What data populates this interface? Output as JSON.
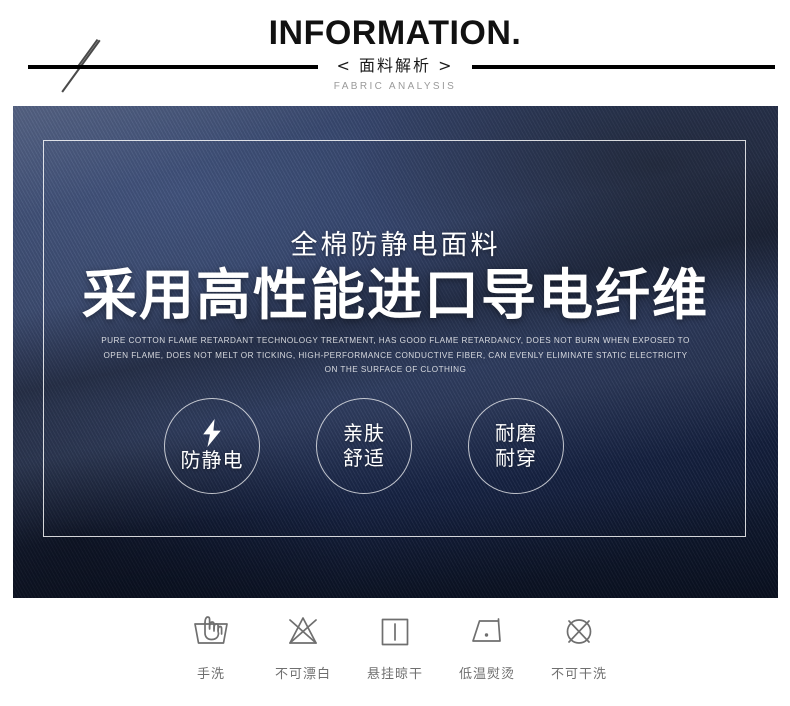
{
  "header": {
    "title": "INFORMATION.",
    "cn_subtitle": "< 面料解析 >",
    "en_subtitle": "FABRIC ANALYSIS",
    "decoration": "diagonal-slashes"
  },
  "hero": {
    "sub_headline": "全棉防静电面料",
    "headline": "采用高性能进口导电纤维",
    "english_description": "PURE COTTON FLAME RETARDANT TECHNOLOGY TREATMENT, HAS GOOD FLAME RETARDANCY, DOES NOT BURN WHEN EXPOSED TO OPEN FLAME, DOES NOT MELT OR TICKING, HIGH-PERFORMANCE CONDUCTIVE FIBER, CAN EVENLY ELIMINATE STATIC ELECTRICITY ON THE SURFACE OF CLOTHING",
    "background_color": "#1b2a4f",
    "frame_color": "#ffffff",
    "features": [
      {
        "icon": "lightning-bolt-icon",
        "line1": "防静电",
        "line2": ""
      },
      {
        "icon": "",
        "line1": "亲肤",
        "line2": "舒适"
      },
      {
        "icon": "",
        "line1": "耐磨",
        "line2": "耐穿"
      }
    ]
  },
  "care_instructions": [
    {
      "icon": "hand-wash-icon",
      "label": "手洗"
    },
    {
      "icon": "do-not-bleach-icon",
      "label": "不可漂白"
    },
    {
      "icon": "line-dry-icon",
      "label": "悬挂晾干"
    },
    {
      "icon": "low-heat-iron-icon",
      "label": "低温熨烫"
    },
    {
      "icon": "do-not-dry-clean-icon",
      "label": "不可干洗"
    }
  ],
  "colors": {
    "navy_dark": "#101a33",
    "navy_mid": "#22325a",
    "navy_light": "#2c406e",
    "rule_black": "#000000",
    "care_gray": "#6f6f6f",
    "en_subtitle_gray": "#9a9a9a"
  }
}
